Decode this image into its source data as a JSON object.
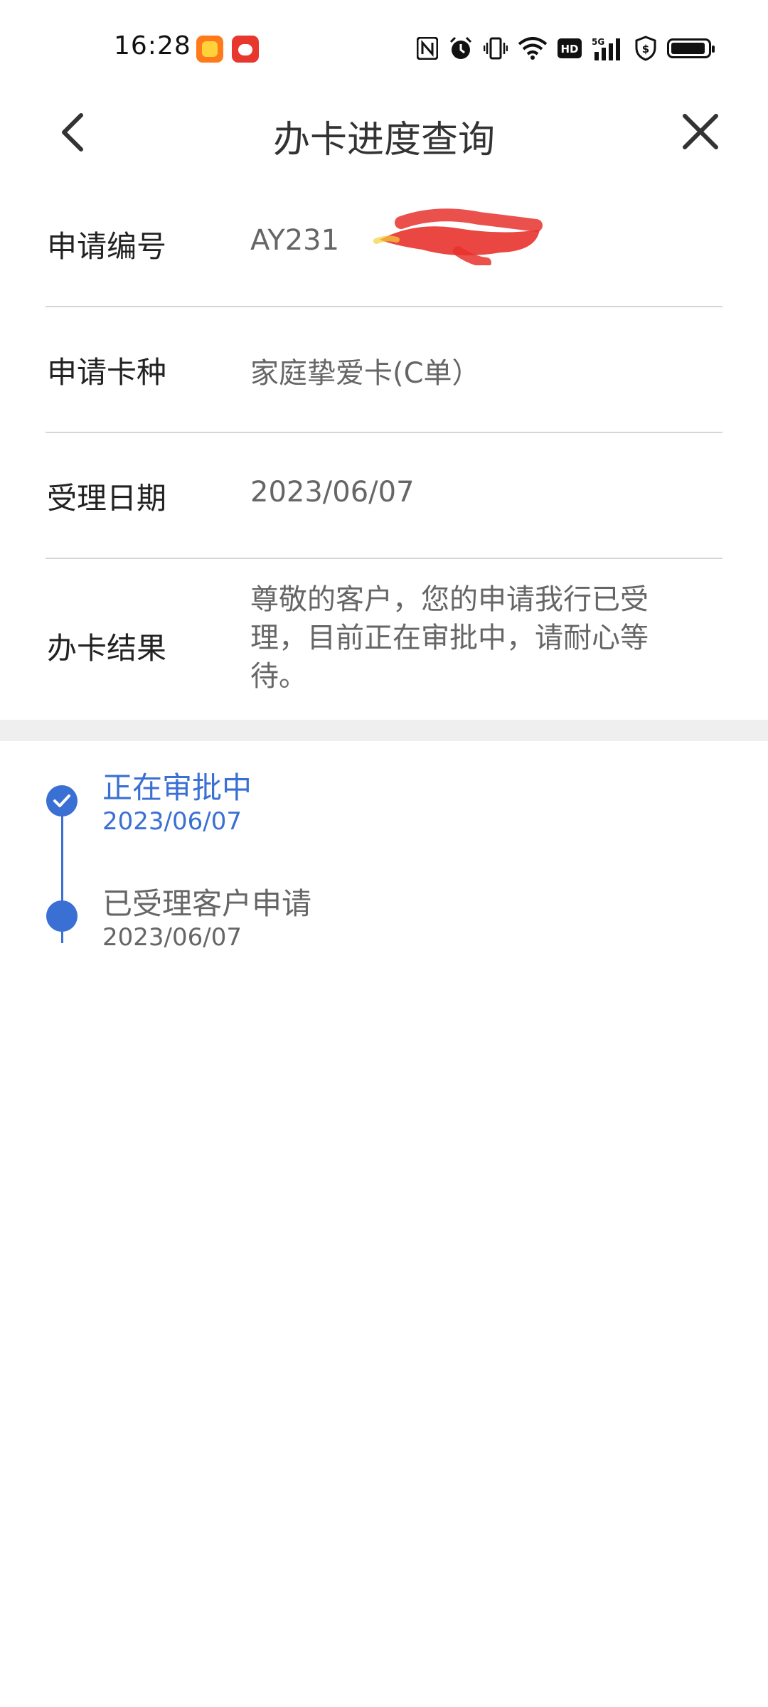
{
  "status_bar": {
    "time": "16:28",
    "left_icons": [
      "taobao-app-icon",
      "pinduoduo-app-icon"
    ],
    "right_icons": [
      "nfc-icon",
      "alarm-icon",
      "vibrate-icon",
      "wifi-icon",
      "hd-icon",
      "5g-signal-icon",
      "shield-icon",
      "battery-icon"
    ]
  },
  "header": {
    "title": "办卡进度查询",
    "back_icon": "chevron-left-icon",
    "close_icon": "close-icon"
  },
  "info": {
    "app_no_label": "申请编号",
    "app_no_value": "AY231",
    "card_type_label": "申请卡种",
    "card_type_value": "家庭挚爱卡(C单）",
    "date_label": "受理日期",
    "date_value": "2023/06/07",
    "result_label": "办卡结果",
    "result_value": "尊敬的客户，您的申请我行已受理，目前正在审批中，请耐心等待。"
  },
  "timeline": {
    "steps": [
      {
        "title": "正在审批中",
        "date": "2023/06/07",
        "icon": "check-circle-icon"
      },
      {
        "title": "已受理客户申请",
        "date": "2023/06/07",
        "icon": "dot-icon"
      }
    ]
  },
  "colors": {
    "accent": "#3a6fd4",
    "label_text": "#222222",
    "value_text": "#666666",
    "divider": "#d6d6d6",
    "separator": "#efefef"
  }
}
